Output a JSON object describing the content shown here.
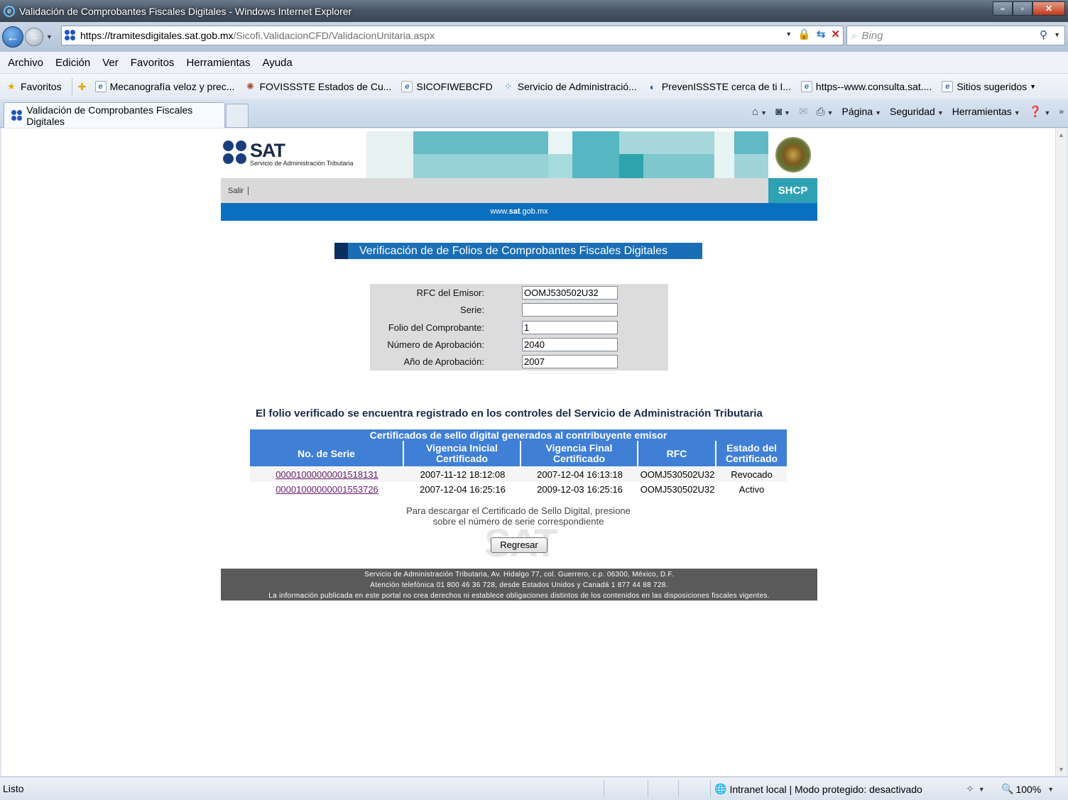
{
  "window": {
    "title": "Validación de Comprobantes Fiscales Digitales - Windows Internet Explorer"
  },
  "address": {
    "url_host": "https://tramitesdigitales.sat.gob.mx",
    "url_path": "/Sicofi.ValidacionCFD/ValidacionUnitaria.aspx",
    "search_placeholder": "Bing"
  },
  "menu": [
    "Archivo",
    "Edición",
    "Ver",
    "Favoritos",
    "Herramientas",
    "Ayuda"
  ],
  "favorites": {
    "label": "Favoritos",
    "items": [
      "Mecanografía veloz y prec...",
      "FOVISSSTE Estados de Cu...",
      "SICOFIWEBCFD",
      "Servicio de Administració...",
      "PrevenISSSTE cerca de ti I...",
      "https--www.consulta.sat....",
      "Sitios sugeridos"
    ]
  },
  "tab": {
    "title": "Validación de Comprobantes Fiscales Digitales"
  },
  "commands": [
    "Página",
    "Seguridad",
    "Herramientas"
  ],
  "header": {
    "logo_text": "SAT",
    "logo_sub": "Servicio de Administración Tributaria",
    "salir": "Salir",
    "shcp": "SHCP",
    "site_prefix": "www.",
    "site_bold": "sat",
    "site_suffix": ".gob.mx"
  },
  "page": {
    "title": "Verificación de de Folios de Comprobantes Fiscales Digitales"
  },
  "form": {
    "rfc_label": "RFC del Emisor:",
    "rfc_value": "OOMJ530502U32",
    "serie_label": "Serie:",
    "serie_value": "",
    "folio_label": "Folio del Comprobante:",
    "folio_value": "1",
    "numero_label": "Número de Aprobación:",
    "numero_value": "2040",
    "anio_label": "Año de Aprobación:",
    "anio_value": "2007"
  },
  "result": {
    "message": "El folio verificado se encuentra registrado en los controles del Servicio de Administración Tributaria"
  },
  "certificates": {
    "caption": "Certificados de sello digital generados al contribuyente emisor",
    "headers": {
      "serie": "No. de Serie",
      "vig_ini_1": "Vigencia Inicial",
      "vig_ini_2": "Certificado",
      "vig_fin_1": "Vigencia Final",
      "vig_fin_2": "Certificado",
      "rfc": "RFC",
      "estado_1": "Estado del",
      "estado_2": "Certificado"
    },
    "rows": [
      {
        "serie": "00001000000001518131",
        "inicio": "2007-11-12 18:12:08",
        "fin": "2007-12-04 16:13:18",
        "rfc": "OOMJ530502U32",
        "estado": "Revocado"
      },
      {
        "serie": "00001000000001553726",
        "inicio": "2007-12-04 16:25:16",
        "fin": "2009-12-03 16:25:16",
        "rfc": "OOMJ530502U32",
        "estado": "Activo"
      }
    ],
    "note_line1": "Para descargar el Certificado de Sello Digital, presione",
    "note_line2": "sobre el número de serie correspondiente"
  },
  "buttons": {
    "regresar": "Regresar"
  },
  "footer": {
    "line1": "Servicio de Administración Tributaria, Av. Hidalgo 77, col. Guerrero, c.p. 06300, México, D.F.",
    "line2": "Atención telefónica 01 800 46 36 728, desde Estados Unidos y Canadá 1 877 44 88 728.",
    "line3": "La información publicada en este portal no crea derechos ni establece obligaciones distintos de los contenidos en las disposiciones fiscales vigentes."
  },
  "status": {
    "text": "Listo",
    "zone": "Intranet local | Modo protegido: desactivado",
    "zoom": "100%"
  },
  "colors": {
    "sat_blue": "#0b6fc0",
    "table_header": "#3f7fd6",
    "footer_gray": "#5a5a5a",
    "shcp_teal": "#2ea1b5"
  }
}
